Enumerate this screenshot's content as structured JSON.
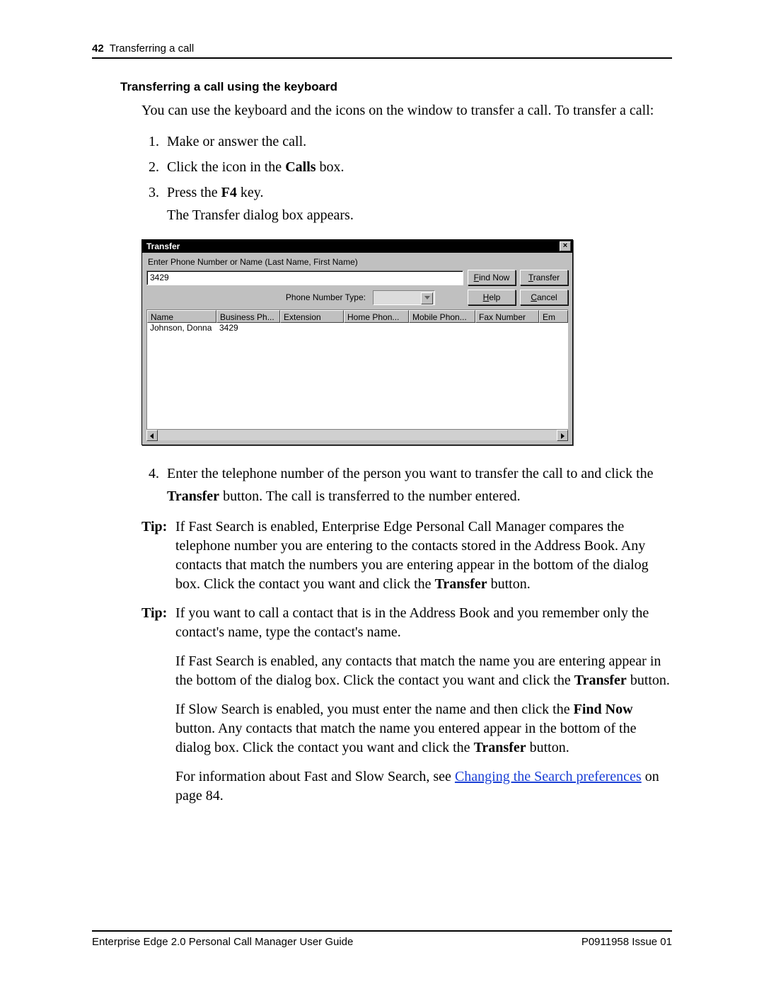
{
  "header": {
    "page_number": "42",
    "running_title": "Transferring a call"
  },
  "section_title": "Transferring a call using the keyboard",
  "intro": "You can use the keyboard and the icons on the window to transfer a call. To transfer a call:",
  "steps": {
    "s1": "Make or answer the call.",
    "s2_pre": "Click the icon in the ",
    "s2_b": "Calls",
    "s2_post": " box.",
    "s3_pre": "Press the ",
    "s3_b": "F4",
    "s3_post": " key.",
    "s3_line2": "The Transfer dialog box appears."
  },
  "dialog": {
    "title": "Transfer",
    "field_label": "Enter Phone Number or Name (Last Name, First Name)",
    "input_value": "3429",
    "btn_find": "Find Now",
    "btn_find_u": "F",
    "btn_transfer": "Transfer",
    "btn_transfer_u": "T",
    "pnt_label": "Phone Number Type:",
    "btn_help": "Help",
    "btn_help_u": "H",
    "btn_cancel": "Cancel",
    "btn_cancel_u": "C",
    "cols": {
      "c0": "Name",
      "c1": "Business Ph...",
      "c2": "Extension",
      "c3": "Home Phon...",
      "c4": "Mobile Phon...",
      "c5": "Fax Number",
      "c6": "Em"
    },
    "row": {
      "name": "Johnson, Donna",
      "ext": "3429"
    }
  },
  "step4": {
    "pre": "Enter the telephone number of the person you want to transfer the call to and click the ",
    "b": "Transfer",
    "post": " button. The call is transferred to the number entered."
  },
  "tip1": {
    "label": "Tip:",
    "p1a": "If Fast Search is enabled, Enterprise Edge Personal Call Manager compares the telephone number you are entering to the contacts stored in the Address Book. Any contacts that match the numbers you are entering appear in the bottom of the dialog box. Click the contact you want and click the ",
    "p1b": "Transfer",
    "p1c": " button."
  },
  "tip2": {
    "label": "Tip:",
    "p1": "If you want to call a contact that is in the Address Book and you remember only the contact's name, type the contact's name.",
    "p2a": "If Fast Search is enabled, any contacts that match the name you are entering appear in the bottom of the dialog box. Click the contact you want and click the ",
    "p2b": "Transfer",
    "p2c": " button.",
    "p3a": "If Slow Search is enabled, you must enter the name and then click the ",
    "p3b": "Find Now",
    "p3c": " button. Any contacts that match the name you entered appear in the bottom of the dialog box. Click the contact you want and click the ",
    "p3d": "Transfer",
    "p3e": " button.",
    "p4a": "For information about Fast and Slow Search, see ",
    "p4link": "Changing the Search preferences",
    "p4b": " on page 84."
  },
  "footer": {
    "left": "Enterprise Edge 2.0 Personal Call Manager User Guide",
    "right": "P0911958 Issue 01"
  }
}
